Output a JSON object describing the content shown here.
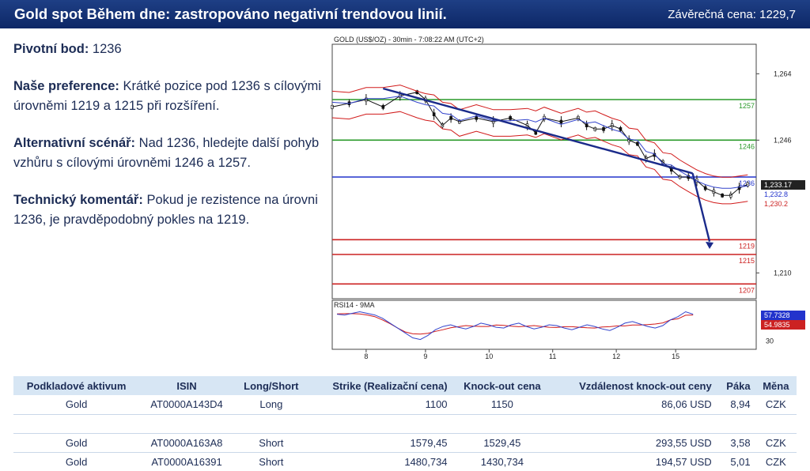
{
  "header": {
    "title": "Gold spot Během dne: zastropováno negativní trendovou linií.",
    "close_label": "Závěrečná cena:",
    "close_value": "1229,7"
  },
  "analysis": {
    "pivot_label": "Pivotní bod:",
    "pivot_value": "1236",
    "preference_label": "Naše preference:",
    "preference_text": "Krátké pozice pod 1236 s cílovými úrovněmi 1219 a 1215 při  rozšíření.",
    "alt_label": "Alternativní scénář:",
    "alt_text": "Nad 1236, hledejte další pohyb vzhůru s cílovými úrovněmi 1246 a 1257.",
    "tech_label": "Technický komentář:",
    "tech_text": "Pokud je rezistence na úrovni 1236, je pravděpodobný pokles na 1219."
  },
  "chart_data": {
    "type": "line",
    "title": "GOLD (US$/OZ) - 30min - 7:08:22 AM (UTC+2)",
    "x_tick_labels": [
      "8",
      "9",
      "10",
      "11",
      "12",
      "15"
    ],
    "y_tick_labels": [
      "1,264",
      "1,246",
      "1,210"
    ],
    "ylim": [
      1203,
      1272
    ],
    "price_series": [
      [
        0,
        1255
      ],
      [
        4,
        1256
      ],
      [
        8,
        1257
      ],
      [
        12,
        1255
      ],
      [
        16,
        1258
      ],
      [
        20,
        1259
      ],
      [
        22,
        1257
      ],
      [
        24,
        1253
      ],
      [
        26,
        1250
      ],
      [
        28,
        1252
      ],
      [
        30,
        1251
      ],
      [
        34,
        1252
      ],
      [
        38,
        1251
      ],
      [
        42,
        1252
      ],
      [
        46,
        1250
      ],
      [
        48,
        1248
      ],
      [
        50,
        1252
      ],
      [
        54,
        1251
      ],
      [
        58,
        1252
      ],
      [
        60,
        1250
      ],
      [
        62,
        1249
      ],
      [
        64,
        1249
      ],
      [
        66,
        1250
      ],
      [
        68,
        1249
      ],
      [
        70,
        1246
      ],
      [
        72,
        1245
      ],
      [
        74,
        1241
      ],
      [
        76,
        1242
      ],
      [
        78,
        1240
      ],
      [
        80,
        1238
      ],
      [
        82,
        1236
      ],
      [
        84,
        1236
      ],
      [
        86,
        1235
      ],
      [
        88,
        1233
      ],
      [
        90,
        1232
      ],
      [
        92,
        1231
      ],
      [
        94,
        1231
      ],
      [
        96,
        1233
      ],
      [
        98,
        1234
      ]
    ],
    "price_x_range": [
      0,
      100
    ],
    "levels": [
      {
        "value": 1257,
        "label": "1257",
        "color": "#2a9a2a"
      },
      {
        "value": 1246,
        "label": "1246",
        "color": "#2a9a2a"
      },
      {
        "value": 1236,
        "label": "1236",
        "color": "#2233cc"
      },
      {
        "value": 1219,
        "label": "1219",
        "color": "#cc2222"
      },
      {
        "value": 1215,
        "label": "1215",
        "color": "#cc2222"
      },
      {
        "value": 1207,
        "label": "1207",
        "color": "#cc2222"
      }
    ],
    "price_tags": [
      {
        "label": "1,233.17",
        "color": "#222222"
      },
      {
        "label": "1,232.8",
        "color": "#2233cc"
      },
      {
        "label": "1,230.2",
        "color": "#cc2222"
      }
    ],
    "rsi": {
      "title": "RSI14 - 9MA",
      "values": [
        63,
        62,
        64,
        66,
        64,
        62,
        58,
        52,
        46,
        40,
        34,
        32,
        37,
        44,
        48,
        50,
        47,
        45,
        48,
        52,
        50,
        47,
        46,
        50,
        52,
        48,
        45,
        47,
        50,
        49,
        46,
        44,
        47,
        50,
        48,
        45,
        43,
        47,
        52,
        54,
        51,
        48,
        46,
        49,
        56,
        60,
        66,
        63
      ],
      "ylim": [
        20,
        80
      ],
      "y_tick_label": "30",
      "tags": [
        {
          "label": "57.7328",
          "color": "#2233cc"
        },
        {
          "label": "54.9835",
          "color": "#cc2222"
        }
      ]
    },
    "colors": {
      "trendline": "#1a2a8a",
      "bands": "#d11a1a",
      "ma": "#3344cc"
    }
  },
  "table": {
    "headers": [
      "Podkladové aktivum",
      "ISIN",
      "Long/Short",
      "Strike (Realizační cena)",
      "Knock-out cena",
      "Vzdálenost knock-out ceny",
      "Páka",
      "Měna"
    ],
    "rows": [
      [
        "Gold",
        "AT0000A143D4",
        "Long",
        "1100",
        "1150",
        "86,06 USD",
        "8,94",
        "CZK"
      ],
      [
        "Gold",
        "AT0000A163A8",
        "Short",
        "1579,45",
        "1529,45",
        "293,55 USD",
        "3,58",
        "CZK"
      ],
      [
        "Gold",
        "AT0000A16391",
        "Short",
        "1480,734",
        "1430,734",
        "194,57 USD",
        "5,01",
        "CZK"
      ]
    ]
  }
}
